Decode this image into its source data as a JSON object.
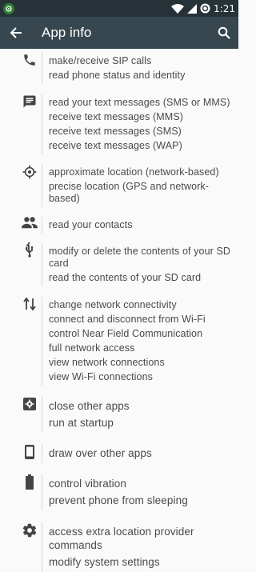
{
  "status_bar": {
    "time": "1:21"
  },
  "app_bar": {
    "title": "App info"
  },
  "groups": [
    {
      "icon": "phone-icon",
      "items": [
        "make/receive SIP calls",
        "read phone status and identity"
      ]
    },
    {
      "icon": "message-icon",
      "items": [
        "read your text messages (SMS or MMS)",
        "receive text messages (MMS)",
        "receive text messages (SMS)",
        "receive text messages (WAP)"
      ]
    },
    {
      "icon": "location-icon",
      "items": [
        "approximate location (network-based)",
        "precise location (GPS and network-based)"
      ]
    },
    {
      "icon": "contacts-icon",
      "items": [
        "read your contacts"
      ]
    },
    {
      "icon": "usb-storage-icon",
      "items": [
        "modify or delete the contents of your SD card",
        "read the contents of your SD card"
      ]
    },
    {
      "icon": "network-arrows-icon",
      "items": [
        "change network connectivity",
        "connect and disconnect from Wi-Fi",
        "control Near Field Communication",
        "full network access",
        "view network connections",
        "view Wi-Fi connections"
      ]
    },
    {
      "icon": "settings-app-icon",
      "items": [
        "close other apps",
        "run at startup"
      ]
    },
    {
      "icon": "phone-device-icon",
      "items": [
        "draw over other apps"
      ]
    },
    {
      "icon": "battery-icon",
      "items": [
        "control vibration",
        "prevent phone from sleeping"
      ]
    },
    {
      "icon": "gear-icon",
      "items": [
        "access extra location provider commands",
        "modify system settings"
      ]
    }
  ]
}
